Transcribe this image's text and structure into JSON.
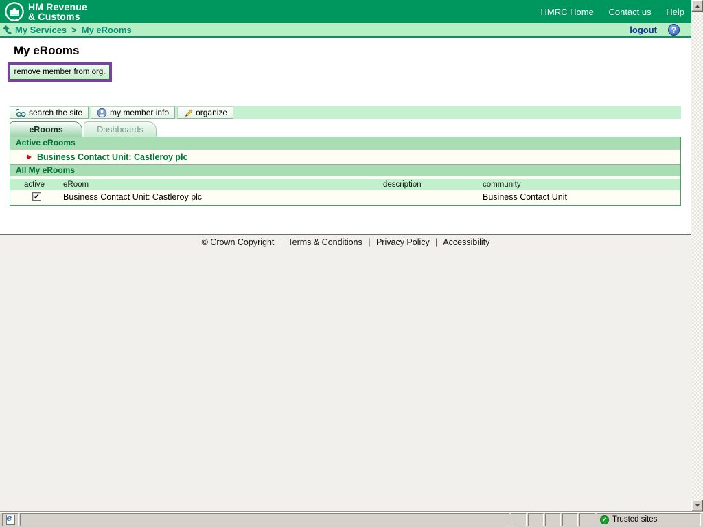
{
  "colors": {
    "header_green": "#00975F",
    "breadcrumb_bg": "#B6EEC6",
    "section_bar_green": "#A9DDB3",
    "table_header_green": "#C2F0CC",
    "link_green": "#007A3C",
    "annotation_purple": "#7E3FA5"
  },
  "header": {
    "logo_line1": "HM Revenue",
    "logo_line2": "& Customs",
    "links": [
      "HMRC Home",
      "Contact us",
      "Help"
    ]
  },
  "breadcrumb": {
    "items": [
      "My Services",
      "My eRooms"
    ],
    "separator": ">",
    "logout_label": "logout",
    "help_glyph": "?"
  },
  "page": {
    "title": "My eRooms",
    "remove_button_label": "remove member from org."
  },
  "toolbar": {
    "buttons": [
      {
        "label": "search the site",
        "icon": "binoculars-icon"
      },
      {
        "label": "my member info",
        "icon": "member-icon"
      },
      {
        "label": "organize",
        "icon": "pencil-icon"
      }
    ]
  },
  "tabs": [
    {
      "label": "eRooms",
      "active": true
    },
    {
      "label": "Dashboards",
      "active": false
    }
  ],
  "active_erooms": {
    "title": "Active eRooms",
    "rooms": [
      "Business Contact Unit: Castleroy plc"
    ]
  },
  "all_my_erooms": {
    "title": "All My eRooms",
    "columns": [
      "active",
      "eRoom",
      "description",
      "community"
    ],
    "rows": [
      {
        "active": true,
        "check_glyph": "✓",
        "eroom": "Business Contact Unit: Castleroy plc",
        "description": "",
        "community": "Business Contact Unit"
      }
    ]
  },
  "footer": {
    "links": [
      "© Crown Copyright",
      "Terms & Conditions",
      "Privacy Policy",
      "Accessibility"
    ],
    "separator": "|"
  },
  "statusbar": {
    "zone_label": "Trusted sites",
    "zone_check_glyph": "✓"
  }
}
